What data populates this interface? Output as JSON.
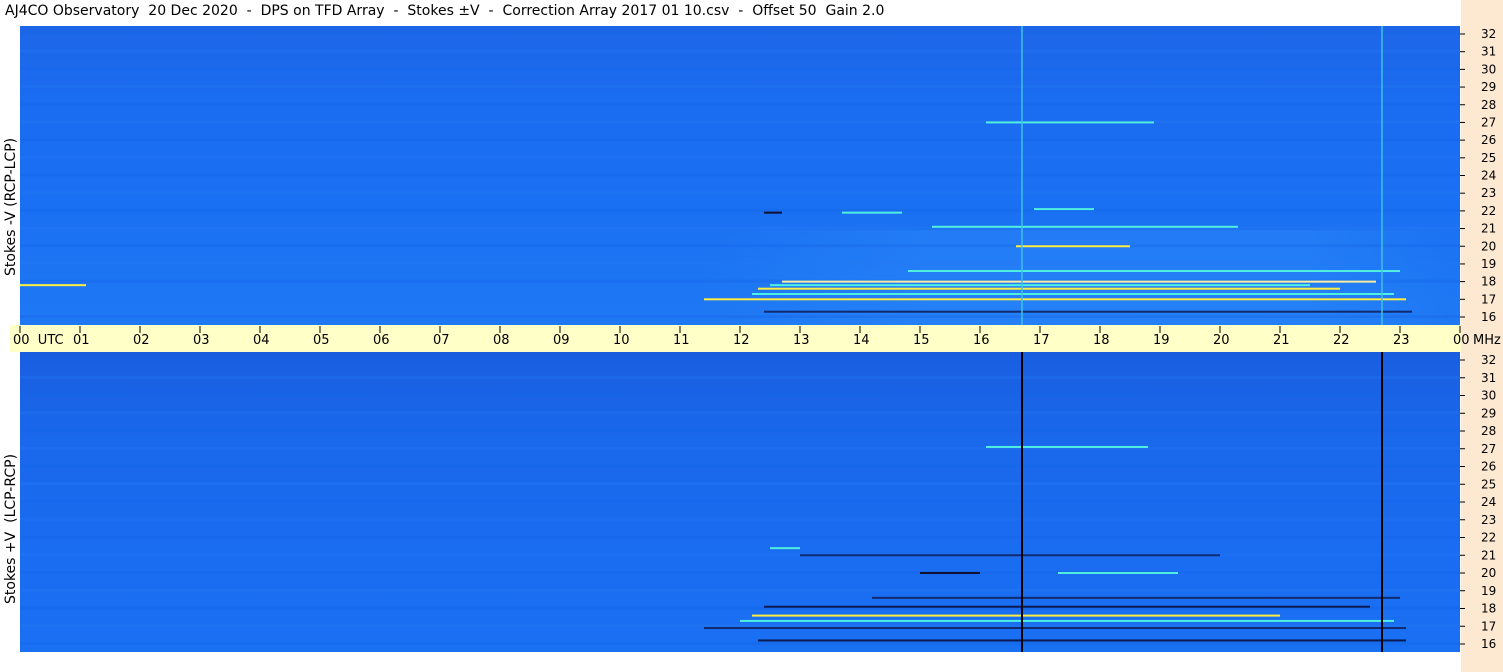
{
  "title": "AJ4CO Observatory  20 Dec 2020  -  DPS on TFD Array  -  Stokes ±V  -  Correction Array 2017 01 10.csv  -  Offset 50  Gain 2.0",
  "colors": {
    "background_blue": "#1a6cf0",
    "hour_bar": "#ffffc8",
    "right_strip": "#fde9d2",
    "top_marker_line": "#40c0f0",
    "bottom_marker_line": "#000000"
  },
  "chart_data": [
    {
      "type": "heatmap",
      "panel": "top",
      "ylabel": "Stokes -V (RCP-LCP)",
      "y_unit": "MHz",
      "y_ticks": [
        "32",
        "31",
        "30",
        "29",
        "28",
        "27",
        "26",
        "25",
        "24",
        "23",
        "22",
        "21",
        "20",
        "19",
        "18",
        "17",
        "16"
      ],
      "ylim": [
        16,
        32
      ],
      "x_ticks": [
        "00  UTC",
        "01",
        "02",
        "03",
        "04",
        "05",
        "06",
        "07",
        "08",
        "09",
        "10",
        "11",
        "12",
        "13",
        "14",
        "15",
        "16",
        "17",
        "18",
        "19",
        "20",
        "21",
        "22",
        "23",
        "00"
      ],
      "xlim": [
        0,
        24
      ],
      "marker_lines_utc": [
        16.7,
        22.7
      ],
      "burst_lines": [
        {
          "freq": 17.0,
          "start": 11.4,
          "end": 23.1,
          "color": "#ffee40"
        },
        {
          "freq": 17.3,
          "start": 12.2,
          "end": 22.9,
          "color": "#50f0e0"
        },
        {
          "freq": 17.6,
          "start": 12.3,
          "end": 22.0,
          "color": "#ffee40"
        },
        {
          "freq": 17.8,
          "start": 12.5,
          "end": 21.5,
          "color": "#50f0e0"
        },
        {
          "freq": 18.0,
          "start": 12.7,
          "end": 22.6,
          "color": "#fff0a0"
        },
        {
          "freq": 18.6,
          "start": 14.8,
          "end": 23.0,
          "color": "#50f0e0"
        },
        {
          "freq": 16.3,
          "start": 12.4,
          "end": 23.2,
          "color": "#102a70"
        },
        {
          "freq": 20.0,
          "start": 16.6,
          "end": 18.5,
          "color": "#ffee40"
        },
        {
          "freq": 21.1,
          "start": 15.2,
          "end": 20.3,
          "color": "#50f0e0"
        },
        {
          "freq": 21.9,
          "start": 12.4,
          "end": 12.7,
          "color": "#101030"
        },
        {
          "freq": 21.9,
          "start": 13.7,
          "end": 14.7,
          "color": "#50f0e0"
        },
        {
          "freq": 22.1,
          "start": 16.9,
          "end": 17.9,
          "color": "#50f0e0"
        },
        {
          "freq": 27.0,
          "start": 16.1,
          "end": 18.9,
          "color": "#50f0e0"
        },
        {
          "freq": 17.8,
          "start": 0.0,
          "end": 1.1,
          "color": "#ffee40"
        }
      ]
    },
    {
      "type": "heatmap",
      "panel": "bottom",
      "ylabel": "Stokes +V  (LCP-RCP)",
      "y_unit": "MHz",
      "y_ticks": [
        "32",
        "31",
        "30",
        "29",
        "28",
        "27",
        "26",
        "25",
        "24",
        "23",
        "22",
        "21",
        "20",
        "19",
        "18",
        "17",
        "16"
      ],
      "ylim": [
        16,
        32
      ],
      "x_ticks": [
        "00  UTC",
        "01",
        "02",
        "03",
        "04",
        "05",
        "06",
        "07",
        "08",
        "09",
        "10",
        "11",
        "12",
        "13",
        "14",
        "15",
        "16",
        "17",
        "18",
        "19",
        "20",
        "21",
        "22",
        "23",
        "00"
      ],
      "xlim": [
        0,
        24
      ],
      "marker_lines_utc": [
        16.7,
        22.7
      ],
      "burst_lines": [
        {
          "freq": 16.2,
          "start": 12.3,
          "end": 23.1,
          "color": "#0a1a50"
        },
        {
          "freq": 16.9,
          "start": 11.4,
          "end": 23.1,
          "color": "#102a70"
        },
        {
          "freq": 17.3,
          "start": 12.0,
          "end": 22.9,
          "color": "#50f0e0"
        },
        {
          "freq": 17.6,
          "start": 12.2,
          "end": 21.0,
          "color": "#ffee40"
        },
        {
          "freq": 18.1,
          "start": 12.4,
          "end": 22.5,
          "color": "#0a1a50"
        },
        {
          "freq": 18.6,
          "start": 14.2,
          "end": 23.0,
          "color": "#102a70"
        },
        {
          "freq": 20.0,
          "start": 15.0,
          "end": 16.0,
          "color": "#101030"
        },
        {
          "freq": 20.0,
          "start": 17.3,
          "end": 19.3,
          "color": "#50f0e0"
        },
        {
          "freq": 21.0,
          "start": 13.0,
          "end": 20.0,
          "color": "#102a70"
        },
        {
          "freq": 21.4,
          "start": 12.5,
          "end": 13.0,
          "color": "#50f0e0"
        },
        {
          "freq": 27.1,
          "start": 16.1,
          "end": 18.8,
          "color": "#50f0e0"
        }
      ]
    }
  ]
}
